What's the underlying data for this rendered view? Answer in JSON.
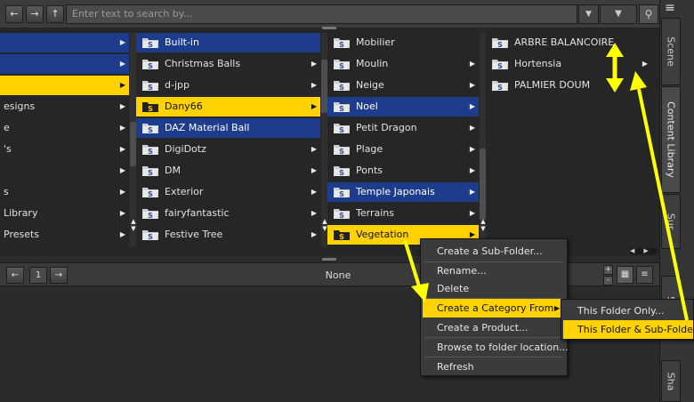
{
  "toolbar": {
    "back_icon": "back-arrow-icon",
    "forward_icon": "forward-arrow-icon",
    "up_icon": "up-folder-icon",
    "search_placeholder": "Enter text to search by...",
    "filter_icon": "search-icon"
  },
  "side_tabs": [
    "Scene",
    "Content Library",
    "Sur",
    "Sm",
    "Sha"
  ],
  "column0": [
    {
      "label": "",
      "style": "blue",
      "arrow": true
    },
    {
      "label": "",
      "style": "blue",
      "arrow": true
    },
    {
      "label": "",
      "style": "yellow",
      "arrow": true
    },
    {
      "label": "esigns",
      "style": "",
      "arrow": true
    },
    {
      "label": "e",
      "style": "",
      "arrow": true
    },
    {
      "label": "'s",
      "style": "",
      "arrow": true
    },
    {
      "label": "",
      "style": "",
      "arrow": true
    },
    {
      "label": "s",
      "style": "",
      "arrow": true
    },
    {
      "label": "Library",
      "style": "",
      "arrow": true
    },
    {
      "label": "Presets",
      "style": "",
      "arrow": true
    }
  ],
  "column1": [
    {
      "label": "Built-in",
      "style": "blue",
      "arrow": false
    },
    {
      "label": "Christmas Balls",
      "style": "",
      "arrow": true
    },
    {
      "label": "d-jpp",
      "style": "",
      "arrow": true
    },
    {
      "label": "Dany66",
      "style": "yellow",
      "arrow": true
    },
    {
      "label": "DAZ Material Ball",
      "style": "blue",
      "arrow": false
    },
    {
      "label": "DigiDotz",
      "style": "",
      "arrow": true
    },
    {
      "label": "DM",
      "style": "",
      "arrow": true
    },
    {
      "label": "Exterior",
      "style": "",
      "arrow": true
    },
    {
      "label": "fairyfantastic",
      "style": "",
      "arrow": true
    },
    {
      "label": "Festive Tree",
      "style": "",
      "arrow": true
    }
  ],
  "column2": [
    {
      "label": "Mobilier",
      "style": "",
      "arrow": false
    },
    {
      "label": "Moulin",
      "style": "",
      "arrow": true
    },
    {
      "label": "Neige",
      "style": "",
      "arrow": true
    },
    {
      "label": "Noel",
      "style": "blue",
      "arrow": true
    },
    {
      "label": "Petit Dragon",
      "style": "",
      "arrow": true
    },
    {
      "label": "Plage",
      "style": "",
      "arrow": true
    },
    {
      "label": "Ponts",
      "style": "",
      "arrow": true
    },
    {
      "label": "Temple Japonais",
      "style": "blue",
      "arrow": true
    },
    {
      "label": "Terrains",
      "style": "",
      "arrow": true
    },
    {
      "label": "Vegetation",
      "style": "yellow",
      "arrow": true
    }
  ],
  "column3": [
    {
      "label": "ARBRE BALANCOIRE",
      "style": "",
      "arrow": false
    },
    {
      "label": "Hortensia",
      "style": "",
      "arrow": true
    },
    {
      "label": "PALMIER DOUM",
      "style": "",
      "arrow": false
    }
  ],
  "pager": {
    "prev_icon": "back-arrow-icon",
    "page": "1",
    "next_icon": "forward-arrow-icon",
    "status": "None",
    "zoom_in": "+",
    "zoom_out": "-",
    "grid_view_icon": "grid-view-icon",
    "list_view_icon": "list-view-icon"
  },
  "context_menu": {
    "items": [
      "Create a Sub-Folder...",
      "Rename...",
      "Delete",
      "Create a Category From",
      "Create a Product...",
      "Browse to folder location...",
      "Refresh"
    ],
    "highlighted": "Create a Category From"
  },
  "submenu": {
    "items": [
      "This Folder Only...",
      "This Folder & Sub-Folders..."
    ],
    "highlighted": "This Folder & Sub-Folders..."
  },
  "colors": {
    "selection_blue": "#1d3d8c",
    "highlight_yellow": "#ffd200",
    "annotation_arrow": "#ffff00"
  }
}
